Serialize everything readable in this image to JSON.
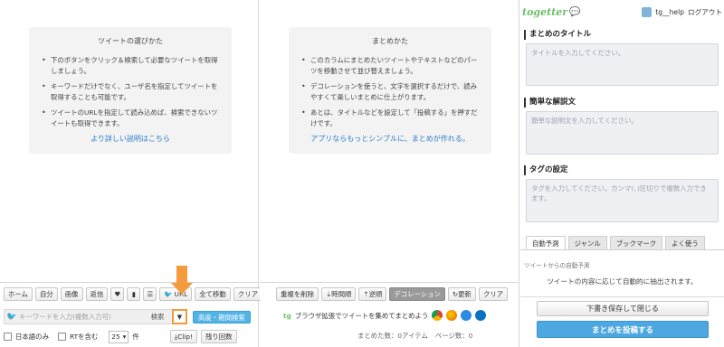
{
  "left_column": {
    "help_title": "ツイートの選びかた",
    "help_items": [
      "下のボタンをクリック＆検索して必要なツイートを取得しましょう。",
      "キーワードだけでなく、ユーザ名を指定してツイートを取得することも可能です。",
      "ツイートのURLを指定して読み込めば、検索できないツイートも取得できます。"
    ],
    "help_link": "より詳しい説明はこちら",
    "toolbar_buttons": [
      "ホーム",
      "自分",
      "画像",
      "返信",
      "",
      "",
      "",
      "URL",
      "全て移動",
      "クリア"
    ],
    "search_placeholder": "キーワードを入力(複数入力可)",
    "search_button": "検索",
    "dropdown_glyph": "▼",
    "advanced_search": "高度・期間検索",
    "japanese_only": "日本語のみ",
    "include_rt": "RTを含む",
    "count_value": "25",
    "count_unit": "件",
    "clip_button": "Clip!",
    "remaining_button": "残り回数"
  },
  "middle_column": {
    "help_title": "まとめかた",
    "help_items": [
      "このカラムにまとめたいツイートやテキストなどのパーツを移動させて並び替えましょう。",
      "デコレーションを使うと、文字を選択するだけで、読みやすくて楽しいまとめに仕上がります。",
      "あとは、タイトルなどを設定して「投稿する」を押すだけです。"
    ],
    "help_link": "アプリならもっとシンプルに、まとめが作れる。",
    "toolbar_buttons": [
      "重複を削除",
      "時間順",
      "逆順",
      "デコレーション",
      "更新",
      "クリア"
    ],
    "extension_text": "ブラウザ拡張でツイートを集めてまとめよう",
    "summary_count": "まとめた数：0アイテム",
    "page_count": "ページ数：0"
  },
  "right_panel": {
    "logo": "togetter",
    "username": "tg__help",
    "logout": "ログアウト",
    "title_label": "まとめのタイトル",
    "title_placeholder": "タイトルを入力してください。",
    "desc_label": "簡単な解説文",
    "desc_placeholder": "簡単な説明文を入力してください。",
    "tag_label": "タグの設定",
    "tag_placeholder": "タグを入力してください。カンマ(、)区切りで複数入力できます。",
    "tabs": [
      "自動予測",
      "ジャンル",
      "ブックマーク",
      "よく使う"
    ],
    "tab_desc": "ツイートからの自動予測",
    "tab_info": "ツイートの内容に応じて自動的に抽出されます。",
    "save_close": "下書き保存して閉じる",
    "post": "まとめを投稿する"
  },
  "colors": {
    "accent_orange": "#f39b3d",
    "accent_blue": "#4da7e0",
    "link_blue": "#2b7bd0",
    "logo_green": "#6dbf6d"
  }
}
